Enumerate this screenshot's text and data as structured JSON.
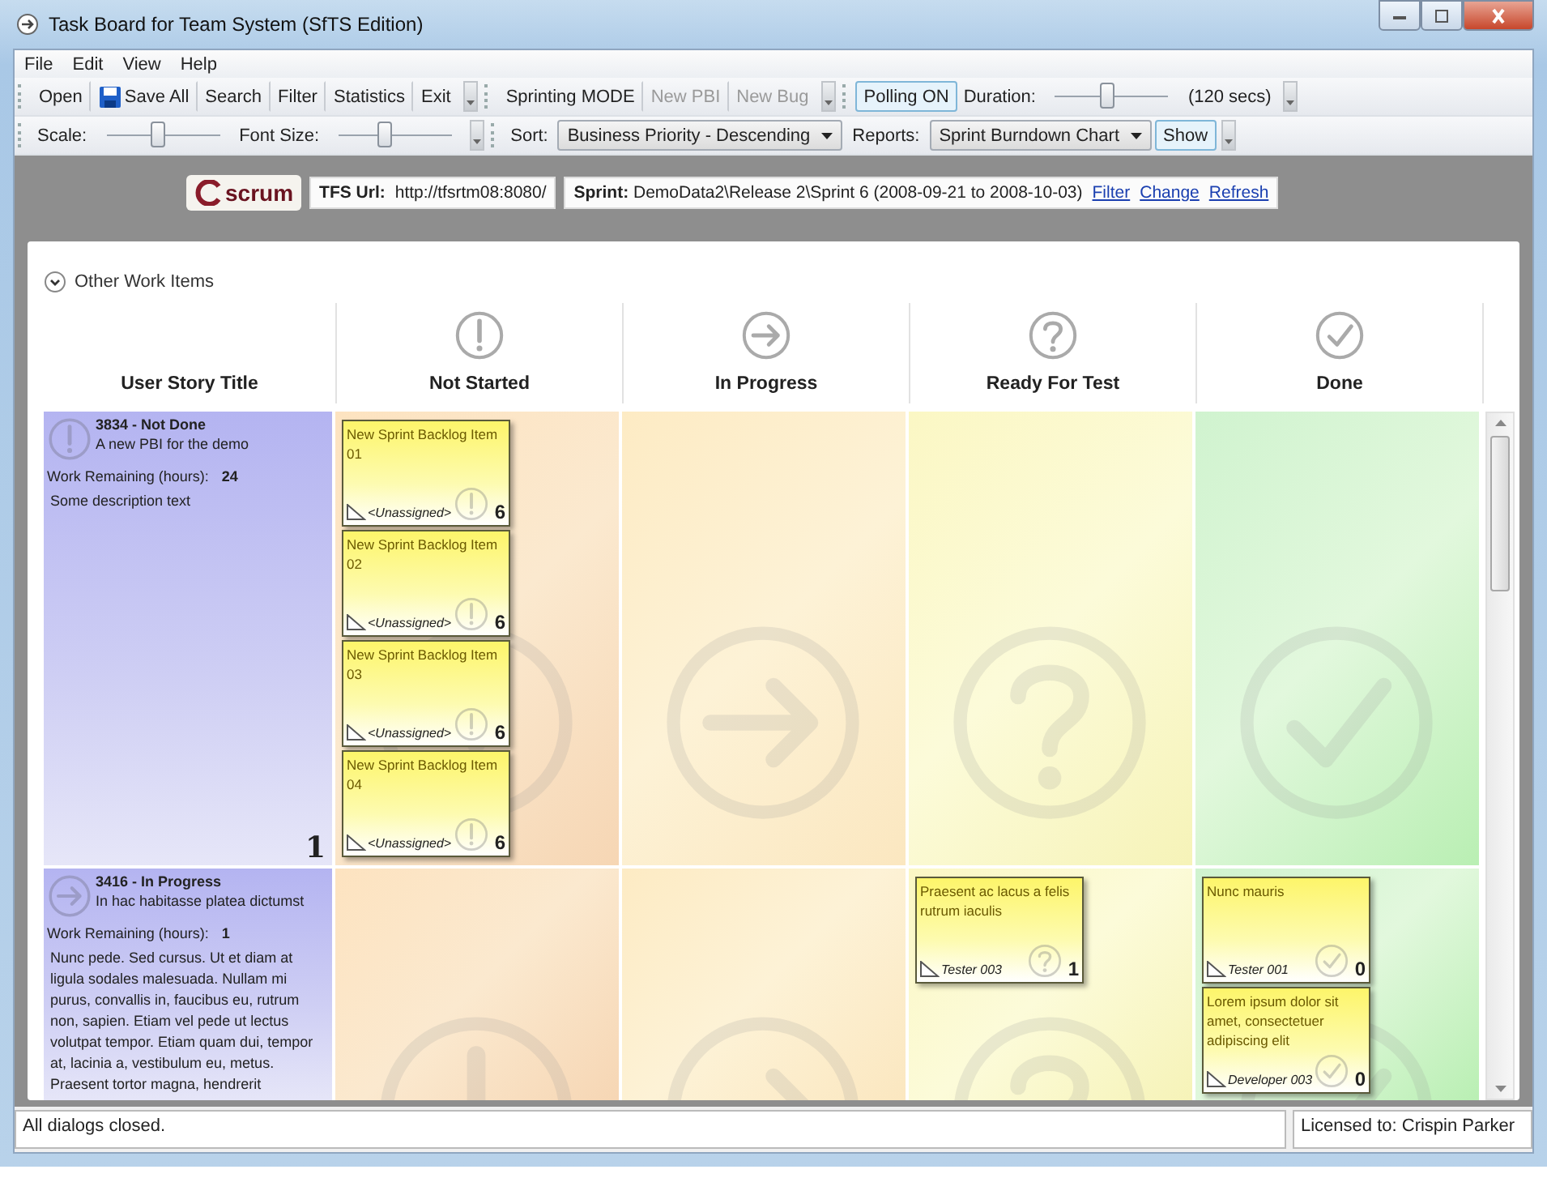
{
  "window": {
    "title": "Task Board for Team System (SfTS Edition)"
  },
  "menu": [
    "File",
    "Edit",
    "View",
    "Help"
  ],
  "toolbar_rows": [
    [
      {
        "items": [
          {
            "kind": "button",
            "label": "Open",
            "disabled": false,
            "highlighted": false
          },
          {
            "kind": "save",
            "label": "Save All",
            "disabled": false,
            "highlighted": false
          },
          {
            "kind": "button",
            "label": "Search",
            "disabled": false,
            "highlighted": false
          },
          {
            "kind": "button",
            "label": "Filter",
            "disabled": false,
            "highlighted": false
          },
          {
            "kind": "button",
            "label": "Statistics",
            "disabled": false,
            "highlighted": false
          },
          {
            "kind": "button",
            "label": "Exit",
            "disabled": false,
            "highlighted": false
          }
        ]
      },
      {
        "items": [
          {
            "kind": "button",
            "label": "Sprinting MODE",
            "disabled": false,
            "highlighted": false
          },
          {
            "kind": "button",
            "label": "New PBI",
            "disabled": true,
            "highlighted": false
          },
          {
            "kind": "button",
            "label": "New Bug",
            "disabled": true,
            "highlighted": false
          }
        ]
      },
      {
        "items": [
          {
            "kind": "button",
            "label": "Polling ON",
            "disabled": false,
            "highlighted": true
          },
          {
            "kind": "label",
            "label": "Duration:"
          },
          {
            "kind": "slider",
            "level": 0.45
          },
          {
            "kind": "label",
            "label": "(120 secs)"
          }
        ]
      }
    ],
    [
      {
        "items": [
          {
            "kind": "label",
            "label": "Scale:"
          },
          {
            "kind": "slider",
            "level": 0.45
          },
          {
            "kind": "label",
            "label": "Font Size:"
          },
          {
            "kind": "slider",
            "level": 0.4
          }
        ]
      },
      {
        "items": [
          {
            "kind": "label",
            "label": "Sort:"
          },
          {
            "kind": "dropdown",
            "label": "Business Priority - Descending"
          },
          {
            "kind": "label",
            "label": "Reports:"
          },
          {
            "kind": "dropdown",
            "label": "Sprint Burndown Chart"
          },
          {
            "kind": "button",
            "label": "Show",
            "disabled": false,
            "highlighted": true
          }
        ]
      }
    ]
  ],
  "header": {
    "logo": "scrum",
    "tfs_label": "TFS Url:",
    "tfs_url": "http://tfsrtm08:8080/",
    "sprint_label": "Sprint:",
    "sprint": "DemoData2\\Release 2\\Sprint 6 (2008-09-21 to 2008-10-03)",
    "links": [
      "Filter",
      "Change",
      "Refresh"
    ]
  },
  "board": {
    "other_items": {
      "label": "Other Work Items",
      "expanded": false
    },
    "story_column": "User Story Title",
    "columns": [
      {
        "title": "Not Started",
        "kind": "exclamation"
      },
      {
        "title": "In Progress",
        "kind": "arrow"
      },
      {
        "title": "Ready For Test",
        "kind": "question"
      },
      {
        "title": "Done",
        "kind": "check"
      }
    ],
    "rows": [
      {
        "story": {
          "kind": "exclamation",
          "title": "3834 - Not Done",
          "summary": "A new PBI for the demo",
          "work_label": "Work Remaining (hours):",
          "work_value": "24",
          "description": "Some description text",
          "count": "1"
        },
        "cells": [
          [
            {
              "title": "New Sprint Backlog Item 01",
              "assignee": "<Unassigned>",
              "number": "6"
            },
            {
              "title": "New Sprint Backlog Item 02",
              "assignee": "<Unassigned>",
              "number": "6"
            },
            {
              "title": "New Sprint Backlog Item 03",
              "assignee": "<Unassigned>",
              "number": "6"
            },
            {
              "title": "New Sprint Backlog Item 04",
              "assignee": "<Unassigned>",
              "number": "6"
            }
          ],
          [],
          [],
          []
        ]
      },
      {
        "story": {
          "kind": "arrow",
          "title": "3416 - In Progress",
          "summary": "In hac habitasse platea dictumst",
          "work_label": "Work Remaining (hours):",
          "work_value": "1",
          "description": "Nunc pede. Sed cursus. Ut et diam at ligula sodales malesuada. Nullam mi purus, convallis in, faucibus eu, rutrum non, sapien. Etiam vel pede ut lectus volutpat tempor. Etiam quam dui, tempor at, lacinia a, vestibulum eu, metus. Praesent tortor magna, hendrerit"
        },
        "cells": [
          [],
          [],
          [
            {
              "title": "Praesent ac lacus a felis rutrum iaculis",
              "assignee": "Tester 003",
              "number": "1"
            }
          ],
          [
            {
              "title": "Nunc mauris",
              "assignee": "Tester 001",
              "number": "0"
            },
            {
              "title": "Lorem ipsum dolor sit amet, consectetuer adipiscing elit",
              "assignee": "Developer 003",
              "number": "0"
            }
          ]
        ]
      }
    ]
  },
  "status_bar": {
    "message": "All dialogs closed.",
    "license": "Licensed to: Crispin Parker"
  }
}
